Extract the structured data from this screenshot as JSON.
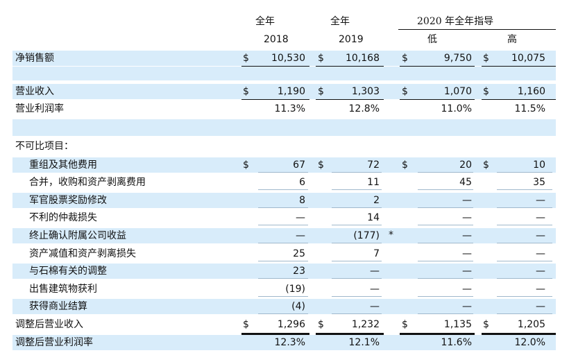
{
  "header": {
    "full_year_a": "全年",
    "full_year_b": "全年",
    "guidance": "2020 年全年指导",
    "year_2018": "2018",
    "year_2019": "2019",
    "low": "低",
    "high": "高"
  },
  "currency_symbol": "$",
  "rows": [
    {
      "label": "净销售额",
      "indent": false,
      "dollar": true,
      "values": [
        "10,530",
        "10,168",
        "9,750",
        "10,075"
      ],
      "shade": true
    },
    {
      "label": "营业收入",
      "indent": false,
      "dollar": true,
      "values": [
        "1,190",
        "1,303",
        "1,070",
        "1,160"
      ],
      "shade": true
    },
    {
      "label": "营业利润率",
      "indent": false,
      "dollar": false,
      "values": [
        "11.3%",
        "12.8%",
        "11.0%",
        "11.5%"
      ],
      "shade": false
    },
    {
      "label": "不可比项目：",
      "indent": false,
      "dollar": false,
      "values": [
        "",
        "",
        "",
        ""
      ],
      "shade": false
    },
    {
      "label": "重组及其他费用",
      "indent": true,
      "dollar": true,
      "values": [
        "67",
        "72",
        "20",
        "10"
      ],
      "shade": true
    },
    {
      "label": "合并，收购和资产剥离费用",
      "indent": true,
      "dollar": false,
      "values": [
        "6",
        "11",
        "45",
        "35"
      ],
      "shade": false
    },
    {
      "label": "军官股票奖励修改",
      "indent": true,
      "dollar": false,
      "values": [
        "8",
        "2",
        "—",
        "—"
      ],
      "shade": true
    },
    {
      "label": "不利的仲裁损失",
      "indent": true,
      "dollar": false,
      "values": [
        "—",
        "14",
        "—",
        "—"
      ],
      "shade": false
    },
    {
      "label": "终止确认附属公司收益",
      "indent": true,
      "dollar": false,
      "values": [
        "—",
        "(177)",
        "—",
        "—"
      ],
      "note": "*",
      "shade": true
    },
    {
      "label": "资产减值和资产剥离损失",
      "indent": true,
      "dollar": false,
      "values": [
        "25",
        "7",
        "—",
        "—"
      ],
      "shade": false
    },
    {
      "label": "与石棉有关的调整",
      "indent": true,
      "dollar": false,
      "values": [
        "23",
        "—",
        "—",
        "—"
      ],
      "shade": true
    },
    {
      "label": "出售建筑物获利",
      "indent": true,
      "dollar": false,
      "values": [
        "(19)",
        "—",
        "—",
        "—"
      ],
      "shade": false
    },
    {
      "label": "获得商业结算",
      "indent": true,
      "dollar": false,
      "values": [
        "(4)",
        "—",
        "—",
        "—"
      ],
      "shade": true
    },
    {
      "label": "调整后营业收入",
      "indent": false,
      "dollar": true,
      "values": [
        "1,296",
        "1,232",
        "1,135",
        "1,205"
      ],
      "shade": false
    },
    {
      "label": "调整后营业利润率",
      "indent": false,
      "dollar": false,
      "values": [
        "12.3%",
        "12.1%",
        "11.6%",
        "12.0%"
      ],
      "shade": true
    }
  ]
}
